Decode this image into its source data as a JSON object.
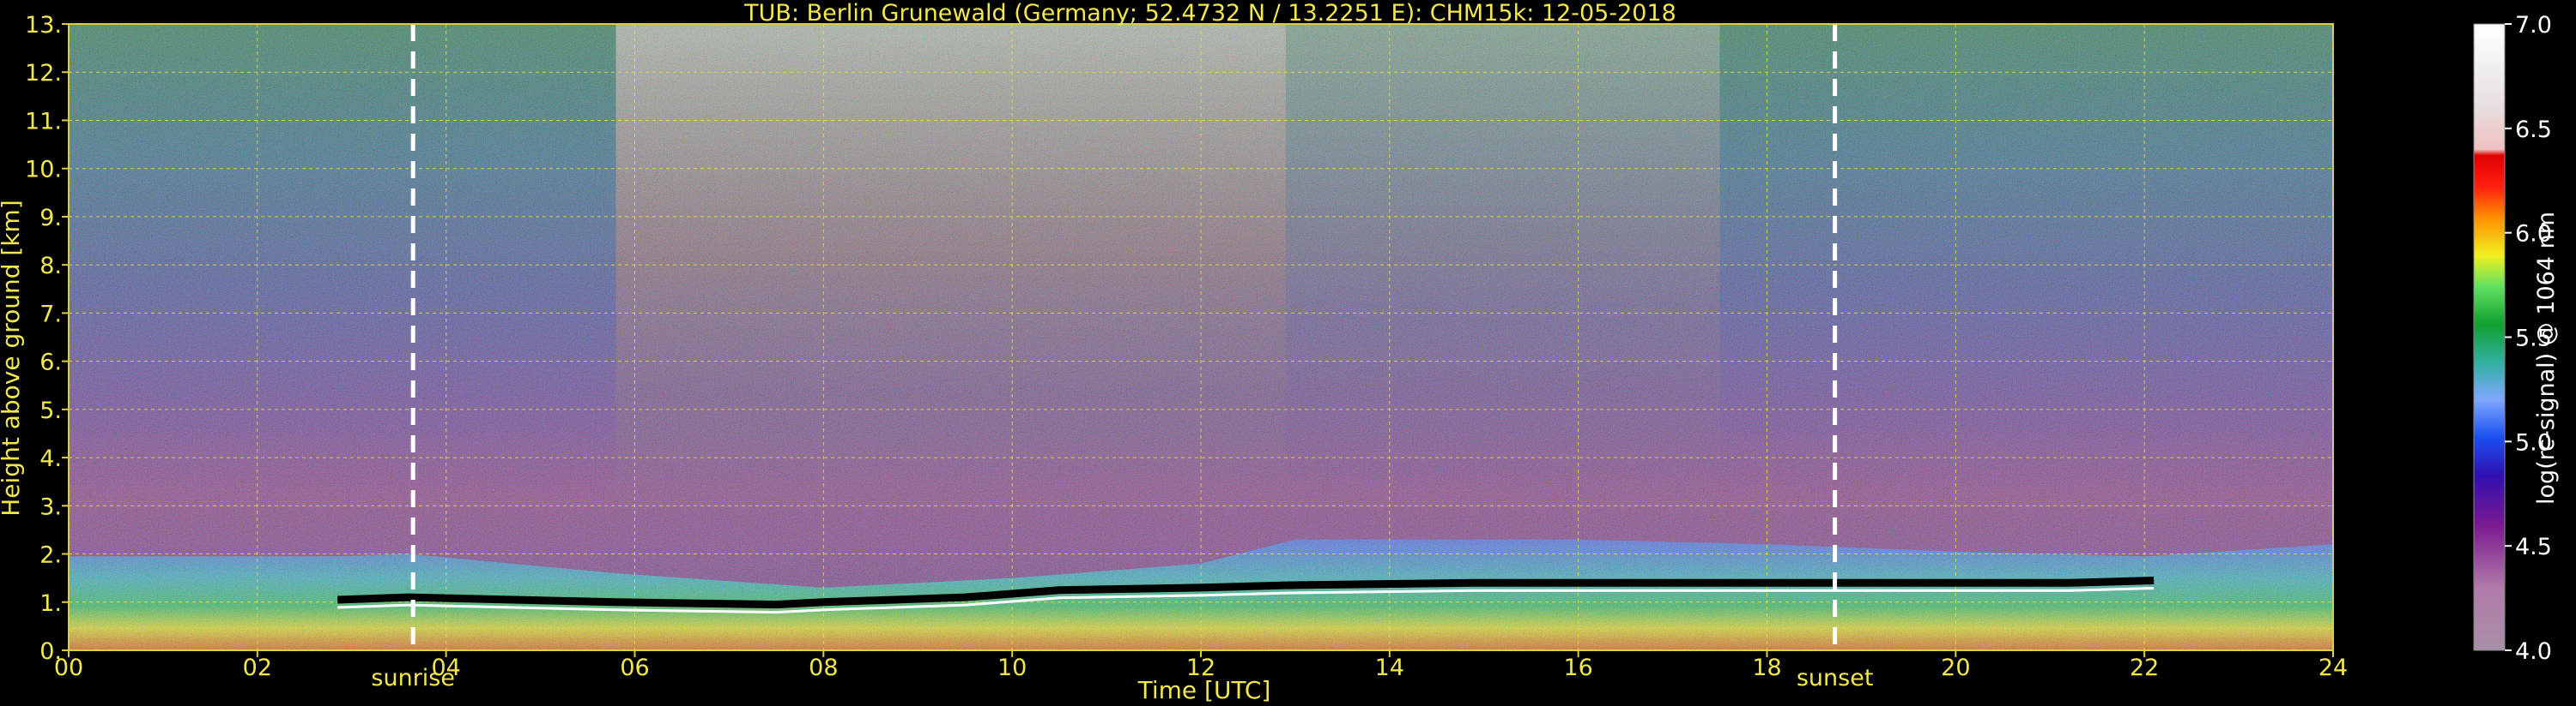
{
  "chart_data": {
    "type": "heatmap",
    "title": "TUB: Berlin Grunewald (Germany; 52.4732 N / 13.2251 E):    CHM15k: 12-05-2018",
    "xlabel": "Time [UTC]",
    "ylabel": "Height above ground [km]",
    "xlim": [
      0,
      24
    ],
    "ylim": [
      0,
      13
    ],
    "x_ticks": [
      0,
      2,
      4,
      6,
      8,
      10,
      12,
      14,
      16,
      18,
      20,
      22,
      24
    ],
    "x_tick_labels": [
      "00",
      "02",
      "04",
      "06",
      "08",
      "10",
      "12",
      "14",
      "16",
      "18",
      "20",
      "22",
      "24"
    ],
    "y_ticks": [
      0,
      1,
      2,
      3,
      4,
      5,
      6,
      7,
      8,
      9,
      10,
      11,
      12,
      13
    ],
    "y_tick_labels": [
      "0.",
      "1.",
      "2.",
      "3.",
      "4.",
      "5.",
      "6.",
      "7.",
      "8.",
      "9.",
      "10.",
      "11.",
      "12.",
      "13."
    ],
    "grid": true,
    "annotations": [
      {
        "label": "sunrise",
        "x": 3.65
      },
      {
        "label": "sunset",
        "x": 18.72
      }
    ],
    "colorbar": {
      "label": "log(rc-signal) @ 1064 nm",
      "range": [
        4.0,
        7.0
      ],
      "ticks": [
        4.0,
        4.5,
        5.0,
        5.5,
        6.0,
        6.5,
        7.0
      ],
      "tick_labels": [
        "4.0",
        "4.5",
        "5.0",
        "5.5",
        "6.0",
        "6.5",
        "7.0"
      ]
    },
    "boundary_layer_top_km": [
      {
        "x": 0,
        "y": 1.95
      },
      {
        "x": 2.8,
        "y": 1.95
      },
      {
        "x": 3.6,
        "y": 2.0
      },
      {
        "x": 5.8,
        "y": 1.6
      },
      {
        "x": 8,
        "y": 1.3
      },
      {
        "x": 10,
        "y": 1.5
      },
      {
        "x": 12,
        "y": 1.8
      },
      {
        "x": 13,
        "y": 2.3
      },
      {
        "x": 16,
        "y": 2.3
      },
      {
        "x": 18,
        "y": 2.2
      },
      {
        "x": 20,
        "y": 2.05
      },
      {
        "x": 22,
        "y": 1.95
      },
      {
        "x": 24,
        "y": 2.2
      }
    ],
    "cloud_base_km": [
      {
        "x": 2.85,
        "y": 1.05
      },
      {
        "x": 3.6,
        "y": 1.1
      },
      {
        "x": 5.8,
        "y": 1.0
      },
      {
        "x": 7.5,
        "y": 0.95
      },
      {
        "x": 8,
        "y": 1.0
      },
      {
        "x": 9.5,
        "y": 1.1
      },
      {
        "x": 10.5,
        "y": 1.25
      },
      {
        "x": 12,
        "y": 1.3
      },
      {
        "x": 12.9,
        "y": 1.35
      },
      {
        "x": 14.9,
        "y": 1.4
      },
      {
        "x": 21.2,
        "y": 1.4
      },
      {
        "x": 22.1,
        "y": 1.45
      }
    ]
  }
}
